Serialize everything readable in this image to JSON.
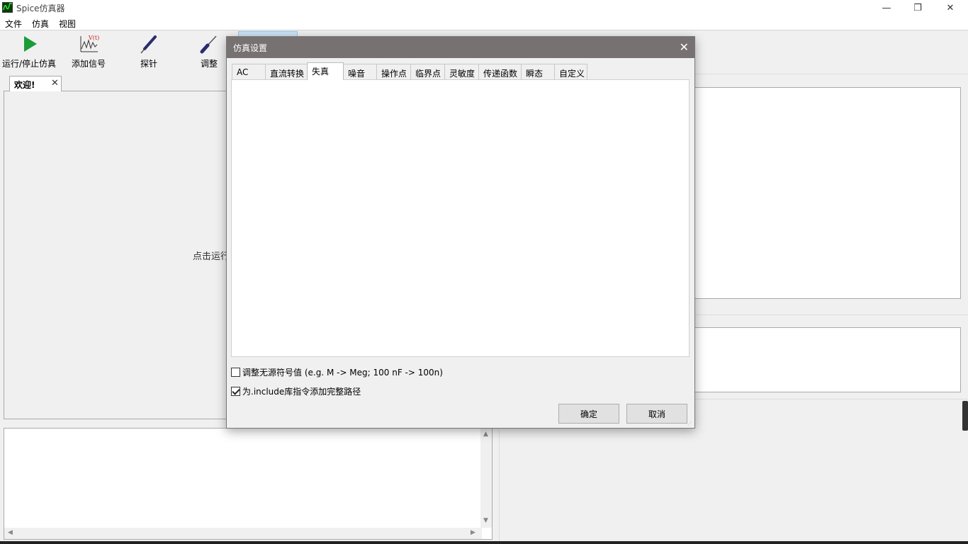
{
  "app": {
    "title": "Spice仿真器"
  },
  "window_controls": {
    "minimize": "—",
    "restore": "❐",
    "close": "✕"
  },
  "menu": [
    "文件",
    "仿真",
    "视图"
  ],
  "toolbar": {
    "run_label": "运行/停止仿真",
    "add_signal_label": "添加信号",
    "probe_label": "探针",
    "adjust_label": "调整"
  },
  "left_tab": {
    "label": "欢迎!",
    "close": "✕",
    "body_text": "点击运行"
  },
  "dialog": {
    "title": "仿真设置",
    "close": "✕",
    "tabs": [
      "AC",
      "直流转换",
      "失真",
      "噪音",
      "操作点",
      "临界点",
      "灵敏度",
      "传递函数",
      "瞬态",
      "自定义"
    ],
    "active_tab": "失真",
    "checkbox1": {
      "label": "调整无源符号值 (e.g. M -> Meg; 100 nF -> 100n)",
      "checked": false
    },
    "checkbox2": {
      "label": "为.include库指令添加完整路径",
      "checked": true
    },
    "ok_label": "确定",
    "cancel_label": "取消"
  },
  "colors": {
    "accent_green": "#1a9c3a",
    "title_gray": "#777171"
  }
}
